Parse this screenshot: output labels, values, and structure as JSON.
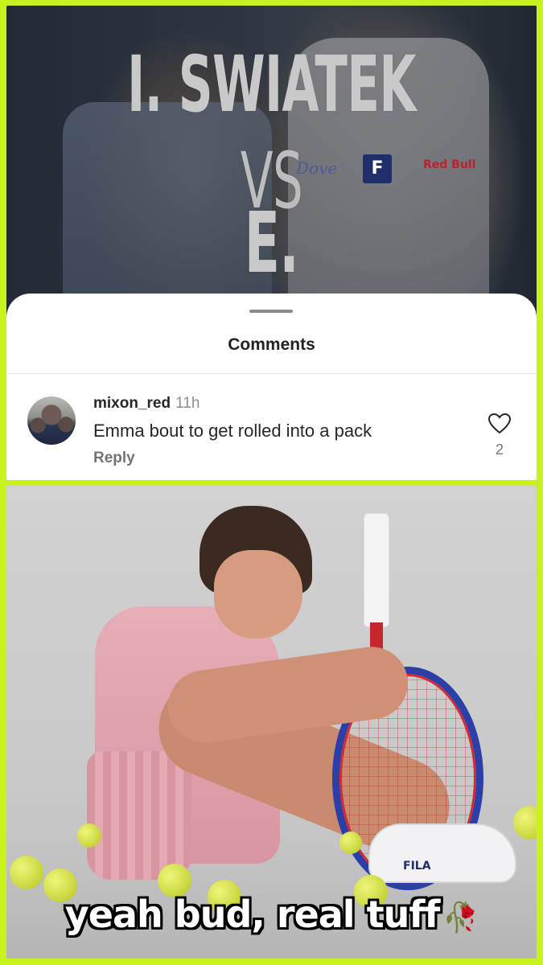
{
  "poster": {
    "line1": "I. SWIATEK",
    "line2": "VS",
    "line3": "E. NAVARRO",
    "sponsor_dove": "Dove",
    "sponsor_fila": "F",
    "sponsor_redbull": "Red Bull"
  },
  "comments_sheet": {
    "title": "Comments",
    "comment": {
      "username": "mixon_red",
      "time": "11h",
      "text": "Emma bout to get rolled into a pack",
      "reply_label": "Reply",
      "like_count": "2"
    }
  },
  "photo": {
    "shoe_brand": "FILA"
  },
  "caption": {
    "text": "yeah bud, real tuff",
    "emoji": "🥀"
  },
  "colors": {
    "frame": "#c8f21c",
    "sheet_bg": "#ffffff"
  },
  "icons": [
    "heart-icon",
    "wilted-rose-emoji"
  ]
}
